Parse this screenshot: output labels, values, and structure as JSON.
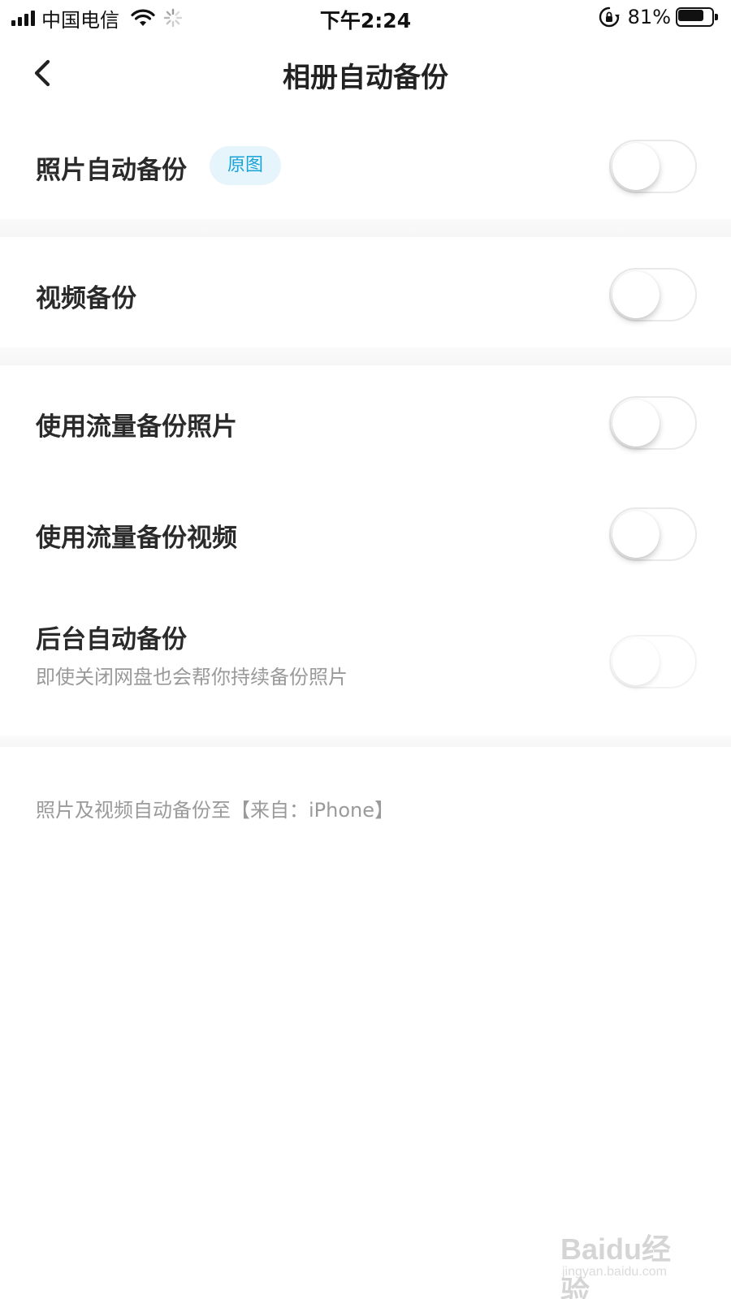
{
  "status_bar": {
    "carrier": "中国电信",
    "time": "下午2:24",
    "battery_percent": "81%",
    "battery_level": 0.81,
    "icons": [
      "signal-icon",
      "wifi-icon",
      "loading-icon",
      "rotation-lock-icon",
      "battery-icon"
    ]
  },
  "nav": {
    "back_icon": "chevron-left-icon",
    "title": "相册自动备份"
  },
  "settings": [
    {
      "label": "照片自动备份",
      "badge": "原图",
      "enabled": false
    },
    {
      "label": "视频备份",
      "enabled": false
    },
    {
      "label": "使用流量备份照片",
      "enabled": false
    },
    {
      "label": "使用流量备份视频",
      "enabled": false
    },
    {
      "label": "后台自动备份",
      "description": "即使关闭网盘也会帮你持续备份照片",
      "enabled": false,
      "disabled": true
    }
  ],
  "footer_note": "照片及视频自动备份至【来自：iPhone】",
  "watermark": {
    "brand": "Baidu经验",
    "url": "jingyan.baidu.com"
  },
  "colors": {
    "badge_bg": "#e6f5fc",
    "badge_text": "#1aa3d6",
    "muted_text": "#9a9a9a",
    "title_text": "#222222"
  }
}
